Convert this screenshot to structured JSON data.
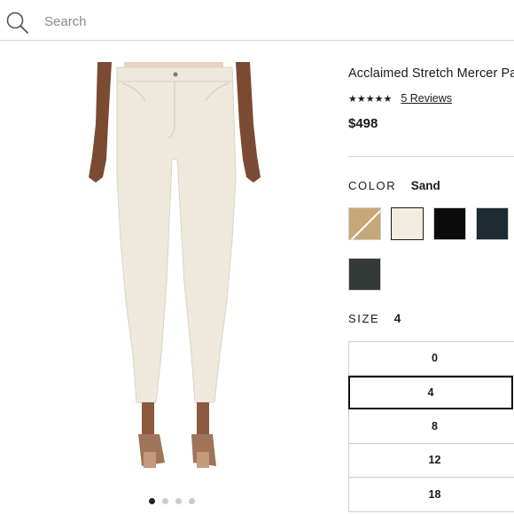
{
  "search": {
    "placeholder": "Search",
    "icon": "search-icon"
  },
  "gallery": {
    "image_count": 4,
    "active_index": 0
  },
  "product": {
    "title": "Acclaimed Stretch Mercer Pa",
    "rating": 4.5,
    "stars_display": "★★★★★",
    "reviews_label": "5 Reviews",
    "price": "$498"
  },
  "color": {
    "label": "COLOR",
    "selected": "Sand",
    "swatches": [
      {
        "name": "tan",
        "hex": "#c7a679",
        "selected": false
      },
      {
        "name": "sand",
        "hex": "#f3ece1",
        "selected": true
      },
      {
        "name": "black",
        "hex": "#0b0b0b",
        "selected": false
      },
      {
        "name": "navy",
        "hex": "#1f2b33",
        "selected": false
      },
      {
        "name": "charcoal",
        "hex": "#333936",
        "selected": false
      }
    ]
  },
  "size": {
    "label": "SIZE",
    "selected": "4",
    "options": [
      "0",
      "4",
      "8",
      "12",
      "18"
    ]
  }
}
